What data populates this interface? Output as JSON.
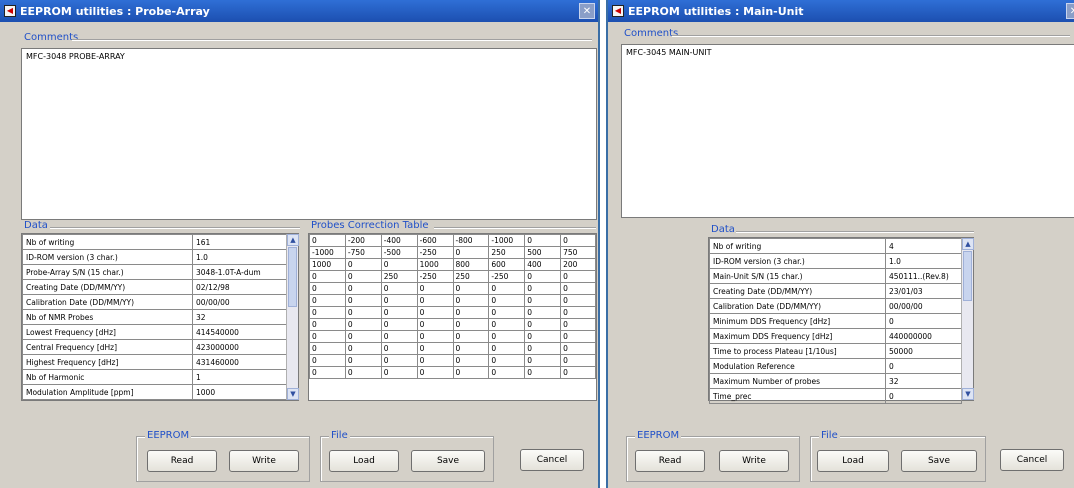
{
  "probe_array": {
    "title": "EEPROM utilities : Probe-Array",
    "comments_label": "Comments",
    "comments_text": "MFC-3048 PROBE-ARRAY",
    "data_label": "Data",
    "data_rows": [
      [
        "Nb of writing",
        "161"
      ],
      [
        "ID-ROM version (3 char.)",
        "1.0"
      ],
      [
        "Probe-Array S/N (15 char.)",
        "3048-1.0T-A-dum"
      ],
      [
        "Creating Date (DD/MM/YY)",
        "02/12/98"
      ],
      [
        "Calibration Date (DD/MM/YY)",
        "00/00/00"
      ],
      [
        "Nb of NMR Probes",
        "32"
      ],
      [
        "Lowest Frequency [dHz]",
        "414540000"
      ],
      [
        "Central Frequency [dHz]",
        "423000000"
      ],
      [
        "Highest Frequency [dHz]",
        "431460000"
      ],
      [
        "Nb of Harmonic",
        "1"
      ],
      [
        "Modulation Amplitude [ppm]",
        "1000"
      ]
    ],
    "correction_label": "Probes Correction Table",
    "correction_rows": [
      [
        "0",
        "-200",
        "-400",
        "-600",
        "-800",
        "-1000",
        "0",
        "0"
      ],
      [
        "-1000",
        "-750",
        "-500",
        "-250",
        "0",
        "250",
        "500",
        "750"
      ],
      [
        "1000",
        "0",
        "0",
        "1000",
        "800",
        "600",
        "400",
        "200"
      ],
      [
        "0",
        "0",
        "250",
        "-250",
        "250",
        "-250",
        "0",
        "0"
      ],
      [
        "0",
        "0",
        "0",
        "0",
        "0",
        "0",
        "0",
        "0"
      ],
      [
        "0",
        "0",
        "0",
        "0",
        "0",
        "0",
        "0",
        "0"
      ],
      [
        "0",
        "0",
        "0",
        "0",
        "0",
        "0",
        "0",
        "0"
      ],
      [
        "0",
        "0",
        "0",
        "0",
        "0",
        "0",
        "0",
        "0"
      ],
      [
        "0",
        "0",
        "0",
        "0",
        "0",
        "0",
        "0",
        "0"
      ],
      [
        "0",
        "0",
        "0",
        "0",
        "0",
        "0",
        "0",
        "0"
      ],
      [
        "0",
        "0",
        "0",
        "0",
        "0",
        "0",
        "0",
        "0"
      ],
      [
        "0",
        "0",
        "0",
        "0",
        "0",
        "0",
        "0",
        "0"
      ]
    ],
    "eeprom_label": "EEPROM",
    "file_label": "File",
    "read": "Read",
    "write": "Write",
    "load": "Load",
    "save": "Save",
    "cancel": "Cancel"
  },
  "main_unit": {
    "title": "EEPROM utilities : Main-Unit",
    "comments_label": "Comments",
    "comments_text": "MFC-3045 MAIN-UNIT",
    "data_label": "Data",
    "data_rows": [
      [
        "Nb of writing",
        "4"
      ],
      [
        "ID-ROM version (3 char.)",
        "1.0"
      ],
      [
        "Main-Unit S/N (15 char.)",
        "450111..(Rev.8)"
      ],
      [
        "Creating Date (DD/MM/YY)",
        "23/01/03"
      ],
      [
        "Calibration Date (DD/MM/YY)",
        "00/00/00"
      ],
      [
        "Minimum DDS Frequency [dHz]",
        "0"
      ],
      [
        "Maximum DDS Frequency [dHz]",
        "440000000"
      ],
      [
        "Time to process Plateau [1/10us]",
        "50000"
      ],
      [
        "Modulation Reference",
        "0"
      ],
      [
        "Maximum Number of probes",
        "32"
      ],
      [
        "Time_prec",
        "0"
      ]
    ],
    "eeprom_label": "EEPROM",
    "file_label": "File",
    "read": "Read",
    "write": "Write",
    "load": "Load",
    "save": "Save",
    "cancel": "Cancel"
  },
  "icons": {
    "close": "close-icon",
    "app": "app-icon",
    "scroll_up": "scroll-up-icon",
    "scroll_down": "scroll-down-icon"
  },
  "colors": {
    "titlebar": "#1c4fb0",
    "group_label": "#2050c8",
    "dialog_bg": "#d4d0c8"
  }
}
